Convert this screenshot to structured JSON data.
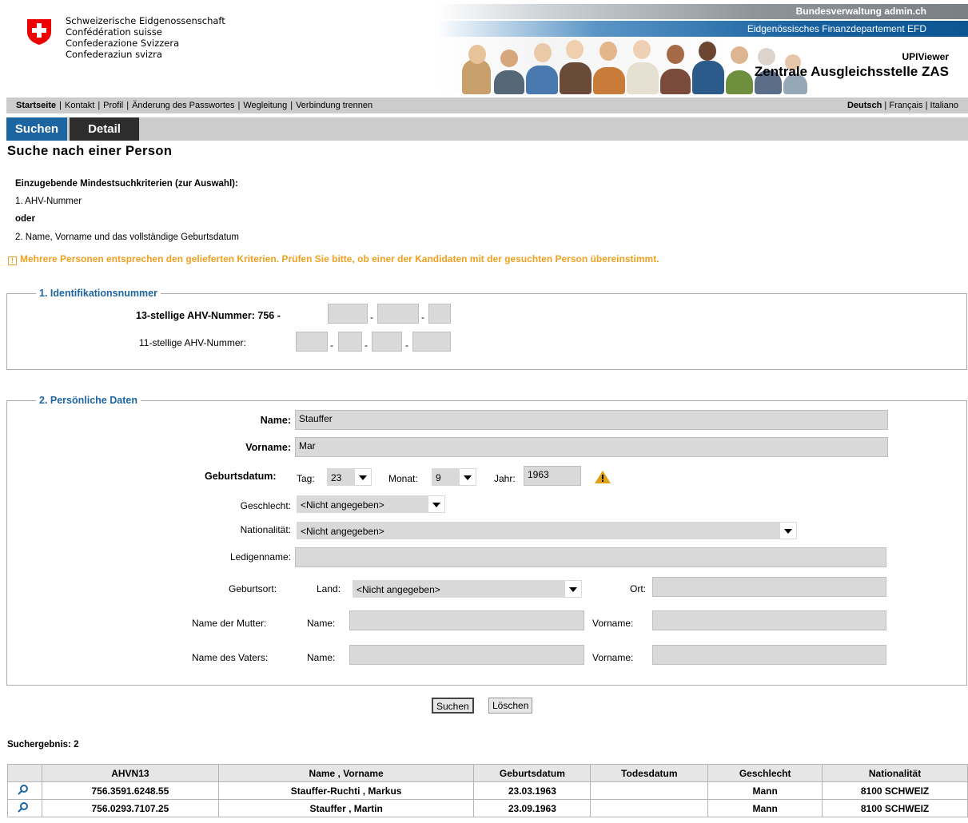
{
  "header": {
    "confederation_names": [
      "Schweizerische Eidgenossenschaft",
      "Confédération suisse",
      "Confederazione Svizzera",
      "Confederaziun svizra"
    ],
    "topbar_1": "Bundesverwaltung admin.ch",
    "topbar_2": "Eidgenössisches Finanzdepartement EFD",
    "app_name": "UPIViewer",
    "department": "Zentrale Ausgleichsstelle ZAS"
  },
  "nav": {
    "items": [
      "Startseite",
      "Kontakt",
      "Profil",
      "Änderung des Passwortes",
      "Wegleitung",
      "Verbindung trennen"
    ],
    "languages": [
      "Deutsch",
      "Français",
      "Italiano"
    ]
  },
  "tabs": [
    "Suchen",
    "Detail"
  ],
  "page_title": "Suche nach einer Person",
  "criteria": {
    "heading": "Einzugebende Mindestsuchkriterien (zur Auswahl):",
    "line1": "1. AHV-Nummer",
    "or": "oder",
    "line2": "2. Name, Vorname und das vollständige Geburtsdatum"
  },
  "warning": "Mehrere Personen entsprechen den gelieferten Kriterien. Prüfen Sie bitte, ob einer der Kandidaten mit der gesuchten Person übereinstimmt.",
  "id_section": {
    "legend": "1. Identifikationsnummer",
    "ahv13_label": "13-stellige AHV-Nummer:",
    "ahv13_prefix": "756 -",
    "ahv11_label": "11-stellige AHV-Nummer:"
  },
  "personal": {
    "legend": "2. Persönliche Daten",
    "name_label": "Name:",
    "name_value": "Stauffer",
    "vorname_label": "Vorname:",
    "vorname_value": "Mar",
    "birth_label": "Geburtsdatum:",
    "tag_label": "Tag:",
    "tag_value": "23",
    "monat_label": "Monat:",
    "monat_value": "9",
    "jahr_label": "Jahr:",
    "jahr_value": "1963",
    "sex_label": "Geschlecht:",
    "sex_value": "<Nicht angegeben>",
    "nat_label": "Nationalität:",
    "nat_value": "<Nicht angegeben>",
    "ledig_label": "Ledigenname:",
    "birthplace_label": "Geburtsort:",
    "land_label": "Land:",
    "land_value": "<Nicht angegeben>",
    "ort_label": "Ort:",
    "mother_label": "Name der Mutter:",
    "father_label": "Name des Vaters:",
    "sub_name_label": "Name:",
    "sub_vorname_label": "Vorname:"
  },
  "buttons": {
    "search": "Suchen",
    "clear": "Löschen"
  },
  "results": {
    "title": "Suchergebnis: 2",
    "columns": [
      "",
      "AHVN13",
      "Name , Vorname",
      "Geburtsdatum",
      "Todesdatum",
      "Geschlecht",
      "Nationalität"
    ],
    "rows": [
      [
        "756.3591.6248.55",
        "Stauffer-Ruchti , Markus",
        "23.03.1963",
        "",
        "Mann",
        "8100 SCHWEIZ"
      ],
      [
        "756.0293.7107.25",
        "Stauffer , Martin",
        "23.09.1963",
        "",
        "Mann",
        "8100 SCHWEIZ"
      ]
    ]
  },
  "colors": {
    "accent_blue": "#1d65a0",
    "warning_orange": "#f0a020",
    "input_grey": "#d9d9d9"
  },
  "icons": [
    "swiss-cross-icon",
    "warning-triangle-icon",
    "info-box-icon",
    "magnifier-icon",
    "dropdown-arrow-icon"
  ]
}
